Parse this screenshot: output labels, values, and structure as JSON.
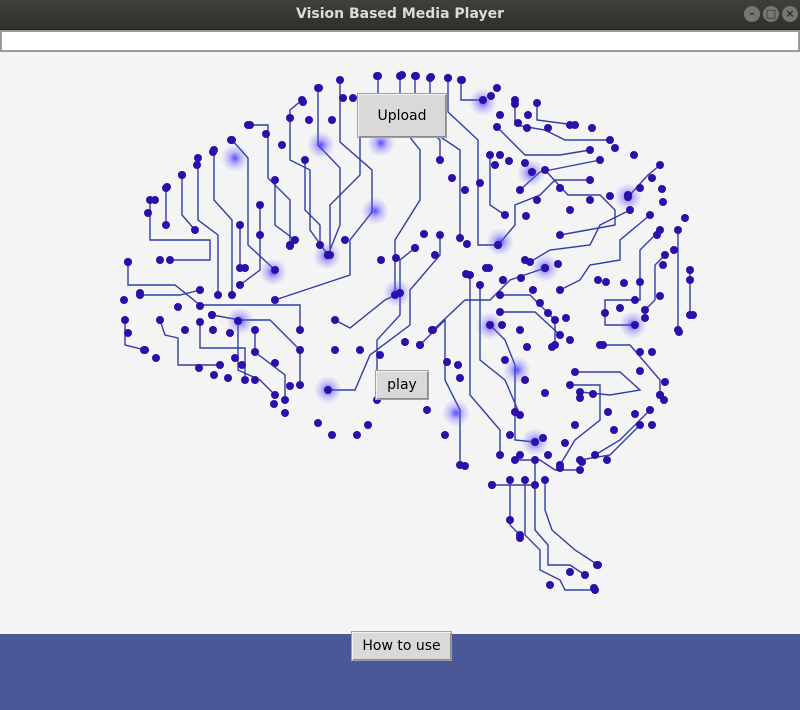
{
  "window": {
    "title": "Vision Based Media Player",
    "controls": {
      "minimize": "–",
      "maximize": "□",
      "close": "×"
    }
  },
  "input": {
    "value": "",
    "placeholder": ""
  },
  "buttons": {
    "upload": "Upload",
    "play": "play",
    "how_to_use": "How to use"
  },
  "image": {
    "subject": "circuit-brain"
  },
  "colors": {
    "titlebar": "#3c3b37",
    "trace": "#2e3fa6",
    "node": "#2b0fa8",
    "glow": "#3b2cff",
    "bottom_bar": "#4a5897",
    "background": "#f4f4f4"
  }
}
